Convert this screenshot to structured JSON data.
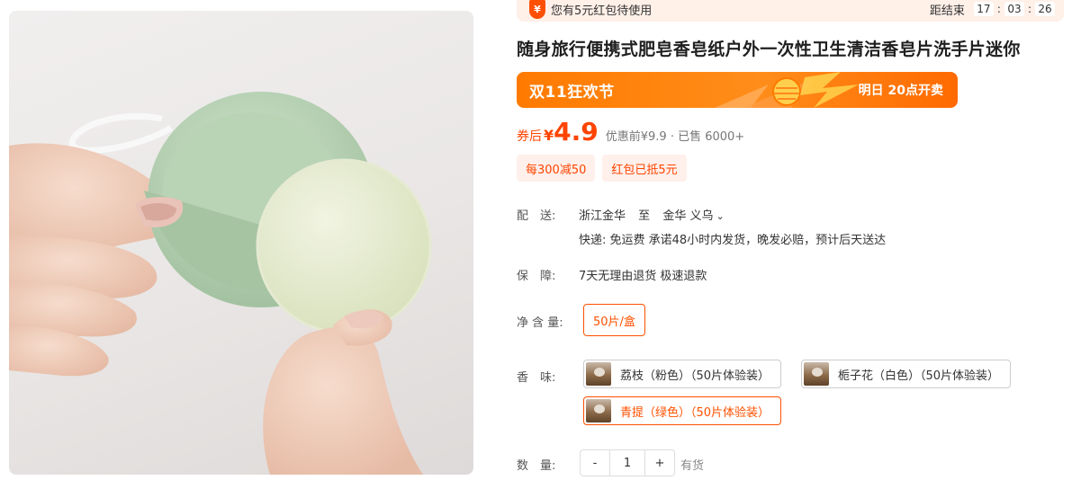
{
  "banner": {
    "coupon_icon": "¥",
    "message": "您有5元红包待使用",
    "end_label": "距结束",
    "hours": "17",
    "minutes": "03",
    "seconds": "26"
  },
  "product": {
    "title": "随身旅行便携式肥皂香皂纸户外一次性卫生清洁香皂片洗手片迷你"
  },
  "promo": {
    "logo": "双11狂欢节",
    "open_time": "明日 20点开卖",
    "colors": {
      "bg": "#ff7a00",
      "accent": "#ff5000"
    }
  },
  "price": {
    "after_label": "券后",
    "currency": "¥",
    "value": "4.9",
    "meta": "优惠前¥9.9 · 已售 6000+"
  },
  "tags": [
    "每300减50",
    "红包已抵5元"
  ],
  "delivery": {
    "label": "配　送:",
    "from": "浙江金华",
    "to_word": "至",
    "to": "金华 义乌",
    "chevron_icon": "chevron-down-icon",
    "express": "快递: 免运费  承诺48小时内发货，晚发必赔，预计后天送达"
  },
  "guarantee": {
    "label": "保　障:",
    "text": "7天无理由退货 极速退款"
  },
  "net": {
    "label": "净 含 量:",
    "options": [
      "50片/盒"
    ]
  },
  "scent": {
    "label": "香　味:",
    "options": [
      "荔枝（粉色）（50片体验装）",
      "栀子花（白色）（50片体验装）",
      "青提（绿色）（50片体验装）"
    ],
    "selected": "青提（绿色）（50片体验装）"
  },
  "quantity": {
    "label": "数　量:",
    "minus": "-",
    "value": "1",
    "plus": "+",
    "stock": "有货"
  }
}
